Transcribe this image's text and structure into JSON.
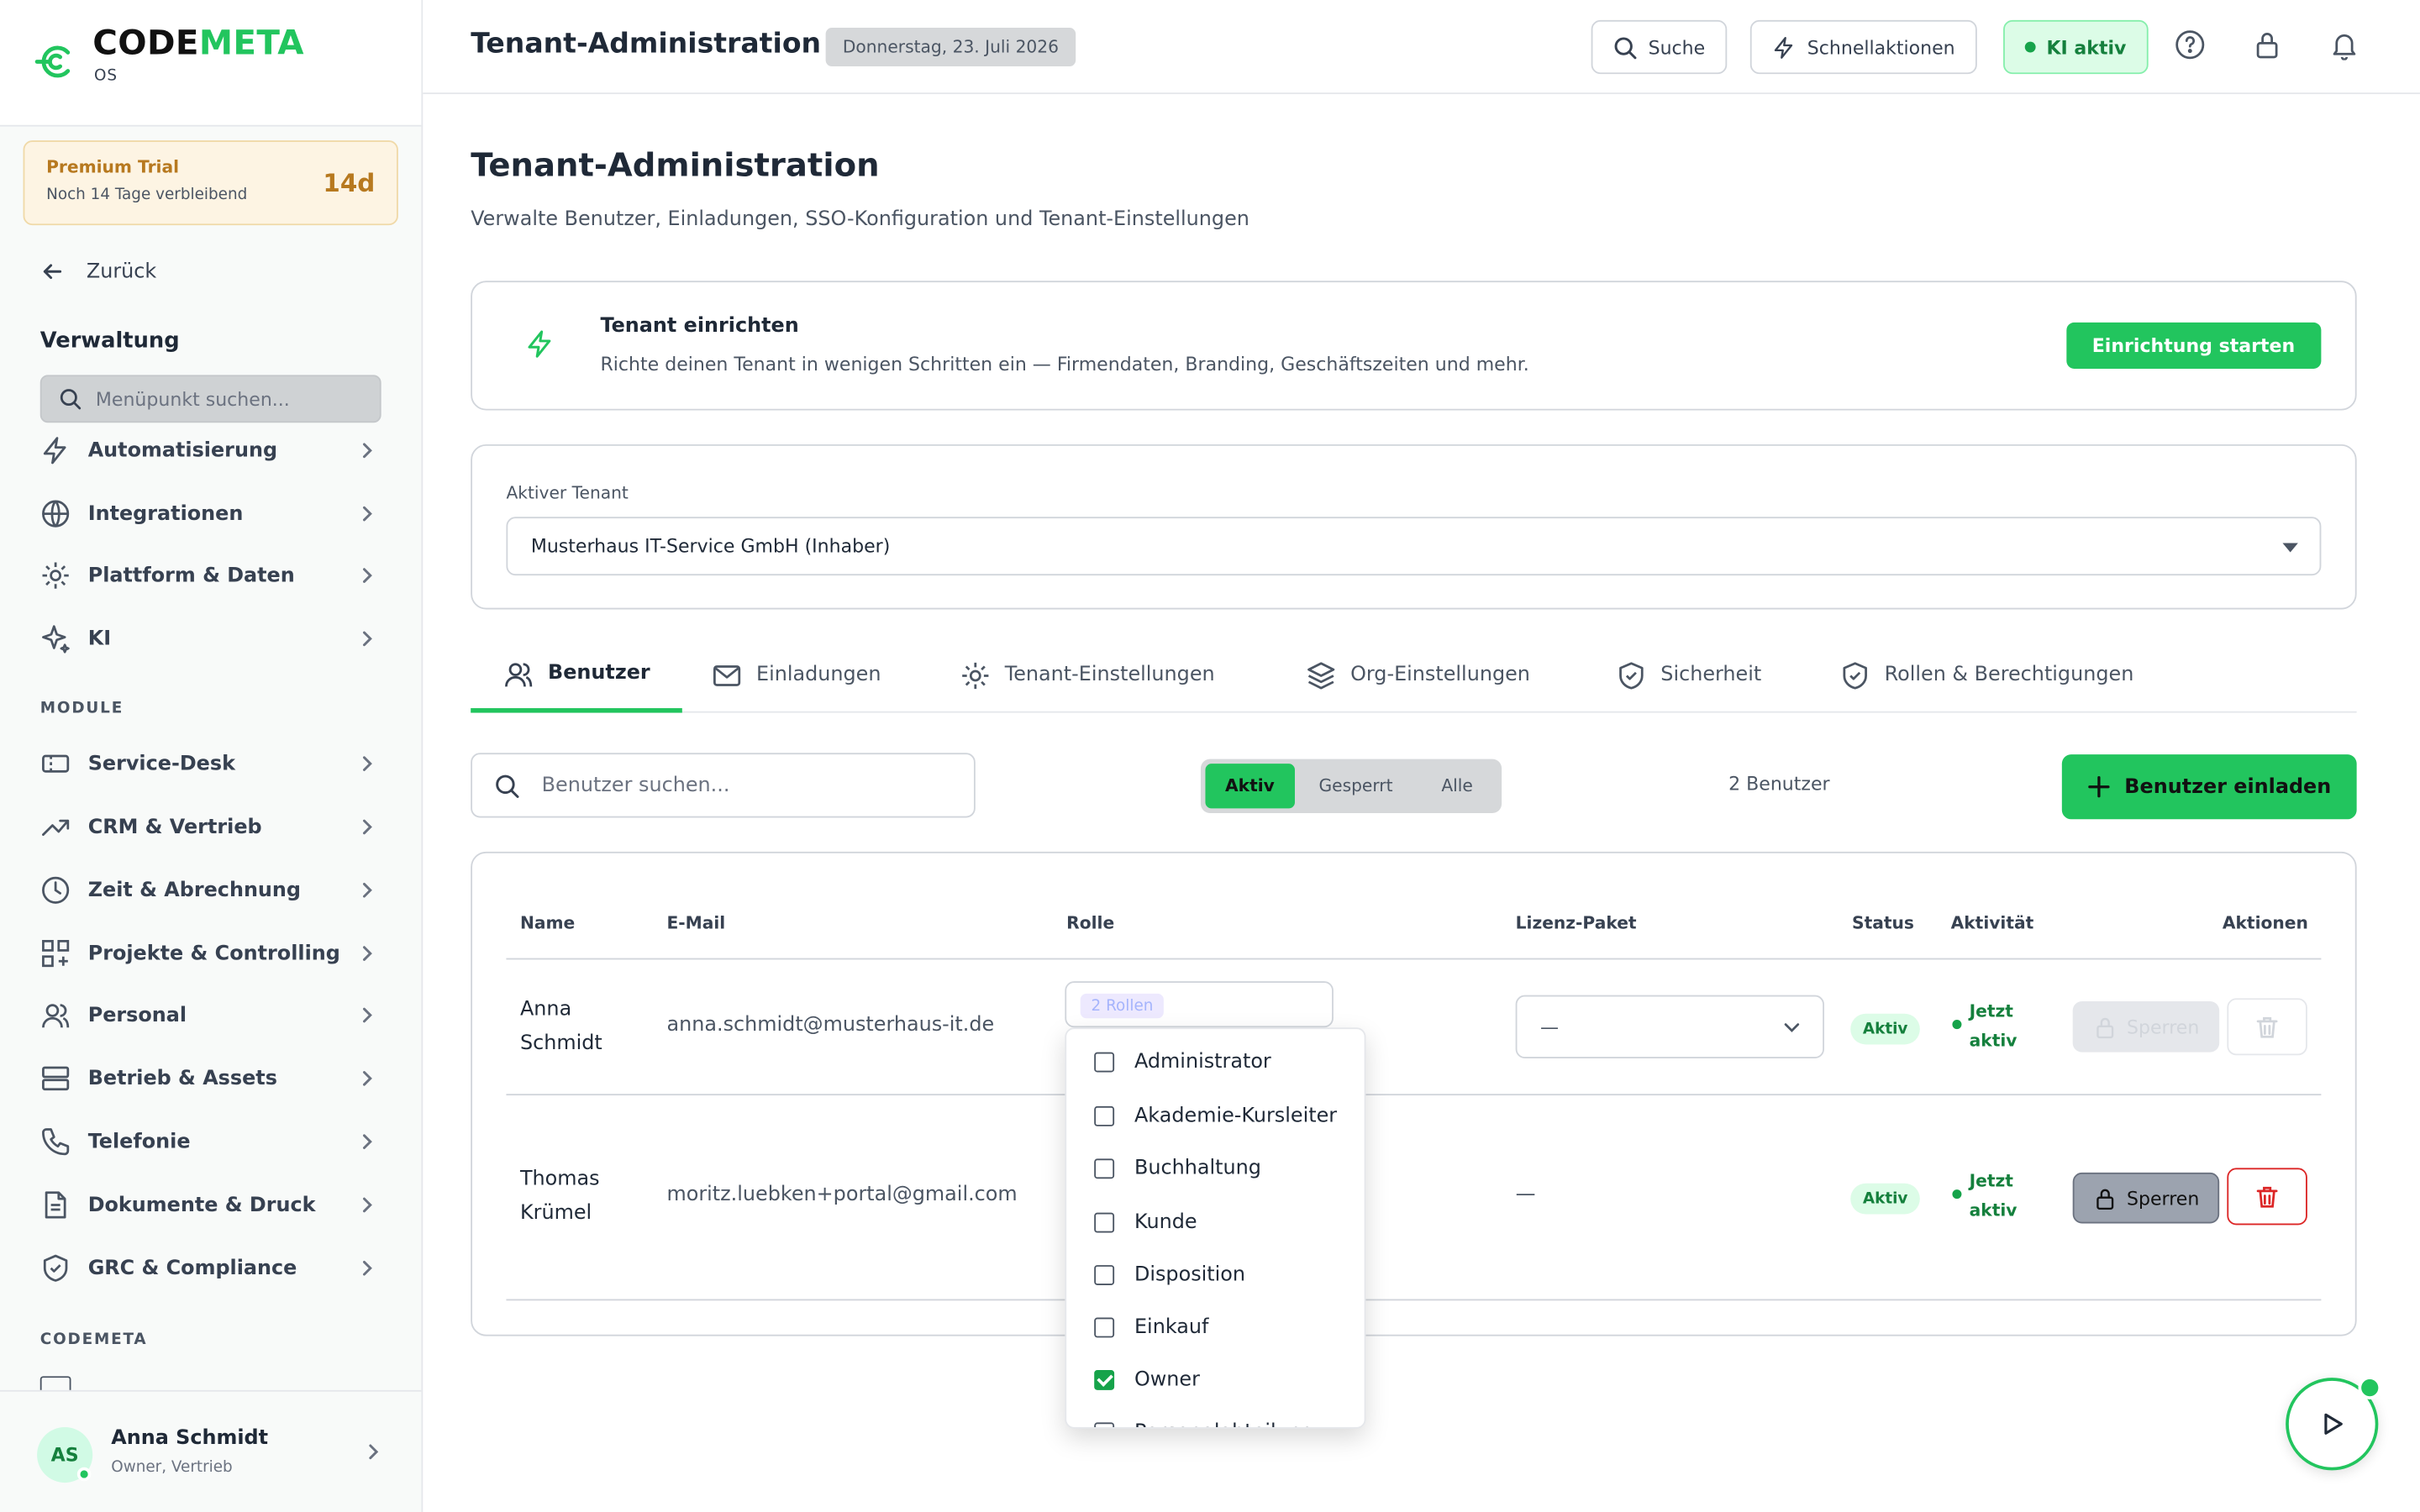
{
  "sidebar": {
    "logo": {
      "word_a": "CODE",
      "word_b": "META",
      "sub": "OS"
    },
    "trial": {
      "title": "Premium Trial",
      "subtitle": "Noch 14 Tage verbleibend",
      "days": "14d"
    },
    "back_label": "Zurück",
    "section_title": "Verwaltung",
    "search_placeholder": "Menüpunkt suchen...",
    "admin_items": [
      {
        "label": "Automatisierung",
        "icon": "lightning-icon"
      },
      {
        "label": "Integrationen",
        "icon": "globe-icon"
      },
      {
        "label": "Plattform & Daten",
        "icon": "gear-icon"
      },
      {
        "label": "KI",
        "icon": "sparkle-icon"
      }
    ],
    "module_group": "MODULE",
    "module_items": [
      {
        "label": "Service-Desk",
        "icon": "ticket-icon"
      },
      {
        "label": "CRM & Vertrieb",
        "icon": "trend-icon"
      },
      {
        "label": "Zeit & Abrechnung",
        "icon": "clock-icon"
      },
      {
        "label": "Projekte & Controlling",
        "icon": "grid-plus-icon"
      },
      {
        "label": "Personal",
        "icon": "people-icon"
      },
      {
        "label": "Betrieb & Assets",
        "icon": "server-icon"
      },
      {
        "label": "Telefonie",
        "icon": "phone-icon"
      },
      {
        "label": "Dokumente & Druck",
        "icon": "document-icon"
      },
      {
        "label": "GRC & Compliance",
        "icon": "shield-icon"
      }
    ],
    "codemeta_group": "CODEMETA",
    "user": {
      "initials": "AS",
      "name": "Anna Schmidt",
      "role": "Owner, Vertrieb"
    }
  },
  "topbar": {
    "title": "Tenant-Administration",
    "date": "Donnerstag, 23. Juli 2026",
    "search_label": "Suche",
    "quick_label": "Schnellaktionen",
    "ki_label": "KI aktiv"
  },
  "main": {
    "title": "Tenant-Administration",
    "subtitle": "Verwalte Benutzer, Einladungen, SSO-Konfiguration und Tenant-Einstellungen",
    "setup": {
      "title": "Tenant einrichten",
      "description": "Richte deinen Tenant in wenigen Schritten ein — Firmendaten, Branding, Geschäftszeiten und mehr.",
      "button": "Einrichtung starten"
    },
    "tenant": {
      "label": "Aktiver Tenant",
      "value": "Musterhaus IT-Service GmbH (Inhaber)"
    },
    "tabs": [
      {
        "label": "Benutzer",
        "icon": "users-icon",
        "active": true
      },
      {
        "label": "Einladungen",
        "icon": "mail-icon"
      },
      {
        "label": "Tenant-Einstellungen",
        "icon": "gear-icon"
      },
      {
        "label": "Org-Einstellungen",
        "icon": "layers-icon"
      },
      {
        "label": "Sicherheit",
        "icon": "shield-check-icon"
      },
      {
        "label": "Rollen & Berechtigungen",
        "icon": "shield-check-icon"
      }
    ],
    "user_search_placeholder": "Benutzer suchen...",
    "filter": {
      "options": [
        "Aktiv",
        "Gesperrt",
        "Alle"
      ],
      "selected": "Aktiv"
    },
    "count": "2 Benutzer",
    "invite_button": "Benutzer einladen",
    "table": {
      "headers": {
        "name": "Name",
        "email": "E-Mail",
        "role": "Rolle",
        "license": "Lizenz-Paket",
        "status": "Status",
        "activity": "Aktivität",
        "actions": "Aktionen"
      },
      "rows": [
        {
          "first": "Anna",
          "last": "Schmidt",
          "email": "anna.schmidt@musterhaus-it.de",
          "roles_badge": "2 Rollen",
          "license": "—",
          "status": "Aktiv",
          "activity_1": "Jetzt",
          "activity_2": "aktiv",
          "lock_label": "Sperren",
          "actions_enabled": false
        },
        {
          "first": "Thomas",
          "last": "Krümel",
          "email": "moritz.luebken+portal@gmail.com",
          "license": "—",
          "status": "Aktiv",
          "activity_1": "Jetzt",
          "activity_2": "aktiv",
          "lock_label": "Sperren",
          "actions_enabled": true
        }
      ]
    },
    "roles_dropdown": [
      {
        "label": "Administrator",
        "checked": false
      },
      {
        "label": "Akademie-Kursleiter",
        "checked": false
      },
      {
        "label": "Buchhaltung",
        "checked": false
      },
      {
        "label": "Kunde",
        "checked": false
      },
      {
        "label": "Disposition",
        "checked": false
      },
      {
        "label": "Einkauf",
        "checked": false
      },
      {
        "label": "Owner",
        "checked": true
      },
      {
        "label": "Personalabteilung",
        "checked": false
      }
    ]
  },
  "colors": {
    "accent": "#22c55e",
    "danger": "#dc2626",
    "warning": "#b7791f"
  }
}
